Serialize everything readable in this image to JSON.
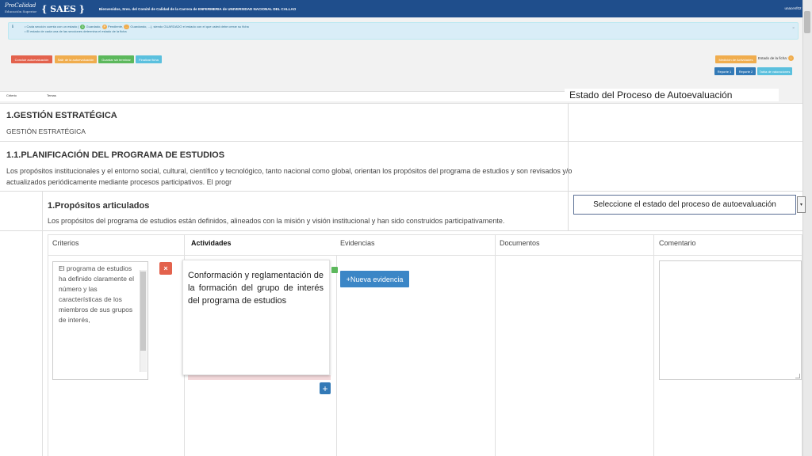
{
  "topbar": {
    "logo_text": "ProCalidad",
    "logo_subtext": "Educación Superior",
    "app_name": "{ SAES }",
    "welcome": "Bienvenidos, Sres. del Comité de Calidad de la Carrera de ENFERMERIA de UNIVERSIDAD NACIONAL DEL CALLAO",
    "user": "unacenf02 ▾"
  },
  "alert": {
    "line1_a": "Cada sección cuenta con un estado (",
    "badge_saved": "G",
    "line1_b": "Guardado,",
    "badge_pending": "P",
    "line1_c": "Pendiente,",
    "badge_saving": "...",
    "line1_d": "Guardando, ...), siendo GUARDADO el estado con el que usted debe cerrar su ficha",
    "line2": "El estado de cada una de las secciones determina el estado de la ficha",
    "close": "×"
  },
  "toolbar": {
    "btn1": "Concluir autoevaluación",
    "btn2": "Salir de la autoevaluación",
    "btn3": "Guardar sin terminar",
    "btn4": "Finalizar ficha",
    "btn_activities": "Medición de Actividades",
    "status_label": "Estado de la ficha:",
    "status_badge": "!",
    "report1": "Reporte 1",
    "report2": "Reporte 2",
    "valuation": "Tabla de valoraciones"
  },
  "table_header": {
    "criterio": "Criterio",
    "temas": "Temas"
  },
  "state_panel_title": "Estado del Proceso de Autoevaluación",
  "section1": {
    "title": "1.GESTIÓN ESTRATÉGICA",
    "subtitle": "GESTIÓN ESTRATÉGICA"
  },
  "section11": {
    "title": "1.1.PLANIFICACIÓN DEL PROGRAMA DE ESTUDIOS",
    "line1": "Los propósitos institucionales y el entorno social, cultural, científico y tecnológico, tanto nacional como global, orientan los propósitos del programa de estudios y son revisados y/o",
    "line2": "actualizados periódicamente mediante procesos participativos. El progr"
  },
  "standard1": {
    "title": "1.Propósitos articulados",
    "desc": "Los propósitos del programa de estudios están definidos, alineados con la misión y visión institucional y han sido construidos participativamente."
  },
  "state_select": {
    "value": "Seleccione el estado del proceso de autoevaluación",
    "arrow": "▾"
  },
  "columns": {
    "criterios": "Criterios",
    "actividades": "Actividades",
    "evidencias": "Evidencias",
    "documentos": "Documentos",
    "comentario": "Comentario"
  },
  "criteria_text": "El programa de estudios ha definido claramente el número y las características de los miembros de sus grupos de interés,",
  "activity_text": "Conformación y reglamentación de la formación del grupo de interés del programa de estudios",
  "buttons": {
    "delete": "×",
    "add": "+",
    "new_evidence": "+Nueva evidencia"
  },
  "colors": {
    "topbar": "#1f4e8c",
    "alert_bg": "#d9edf7",
    "primary": "#3b86c6",
    "danger": "#e3624d"
  }
}
